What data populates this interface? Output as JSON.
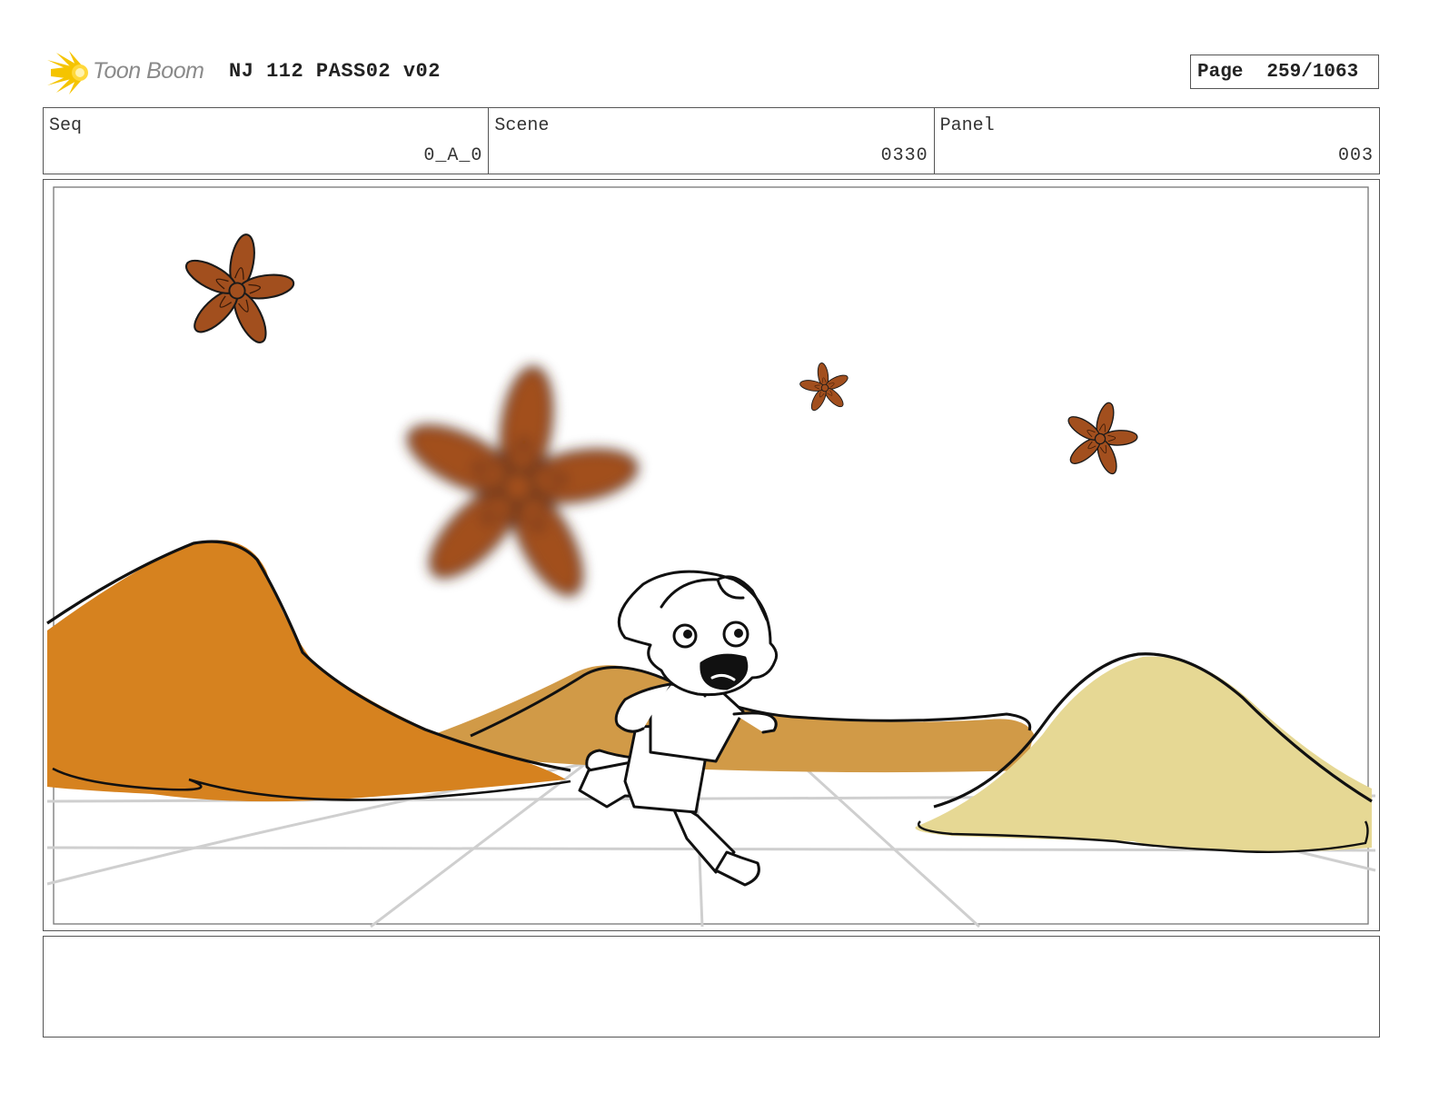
{
  "header": {
    "logo_text": "Toon Boom",
    "title": "NJ 112 PASS02 v02",
    "page_label": "Page",
    "page_value": "259/1063"
  },
  "info": {
    "seq_label": "Seq",
    "seq_value": "0_A_0",
    "scene_label": "Scene",
    "scene_value": "0330",
    "panel_label": "Panel",
    "panel_value": "003"
  },
  "notes": {
    "text": ""
  },
  "colors": {
    "hill_left": "#d6821f",
    "hill_middle": "#d19a47",
    "mound_right": "#e6d894",
    "star_anise": "#a24f1e",
    "logo_sun": "#f5c400"
  }
}
